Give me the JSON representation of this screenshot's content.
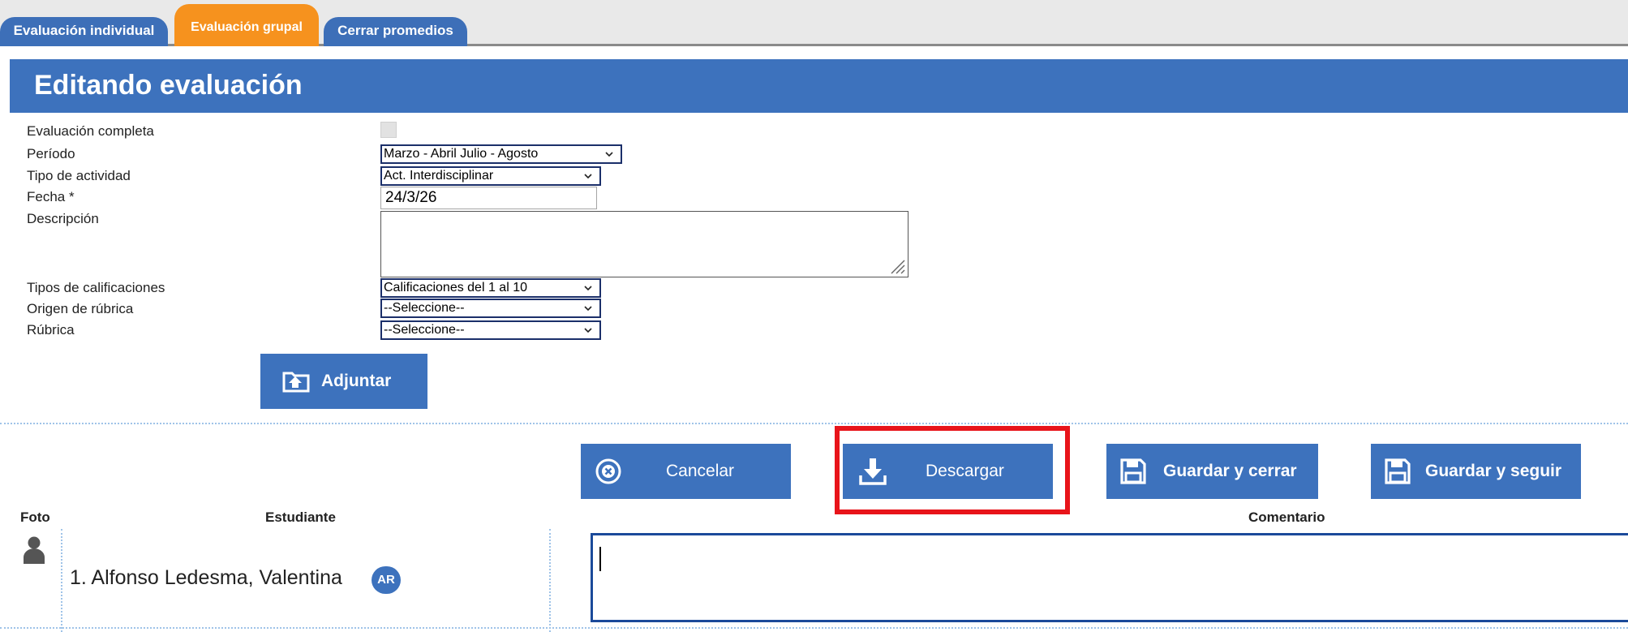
{
  "tabs": [
    {
      "label": "Evaluación individual",
      "active": false
    },
    {
      "label": "Evaluación grupal",
      "active": true
    },
    {
      "label": "Cerrar promedios",
      "active": false
    }
  ],
  "header": {
    "title": "Editando evaluación"
  },
  "form": {
    "evaluacion_completa": {
      "label": "Evaluación completa",
      "checked": false
    },
    "periodo": {
      "label": "Período",
      "value": "Marzo - Abril Julio - Agosto"
    },
    "tipo_actividad": {
      "label": "Tipo de actividad",
      "value": "Act. Interdisciplinar"
    },
    "fecha": {
      "label": "Fecha *",
      "value": "24/3/26"
    },
    "descripcion": {
      "label": "Descripción",
      "value": ""
    },
    "tipos_calificaciones": {
      "label": "Tipos de calificaciones",
      "value": "Calificaciones del 1 al 10"
    },
    "origen_rubrica": {
      "label": "Origen de rúbrica",
      "value": "--Seleccione--"
    },
    "rubrica": {
      "label": "Rúbrica",
      "value": "--Seleccione--"
    }
  },
  "buttons": {
    "adjuntar": "Adjuntar",
    "cancelar": "Cancelar",
    "descargar": "Descargar",
    "guardar_cerrar": "Guardar y cerrar",
    "guardar_seguir": "Guardar y seguir"
  },
  "table": {
    "headers": {
      "foto": "Foto",
      "estudiante": "Estudiante",
      "comentario": "Comentario"
    },
    "rows": [
      {
        "student": "1. Alfonso Ledesma, Valentina",
        "badge": "AR",
        "comment": ""
      }
    ]
  },
  "colors": {
    "accent_blue": "#3d72bd",
    "tab_active_orange": "#f6921e",
    "highlight_red": "#e8141a"
  }
}
